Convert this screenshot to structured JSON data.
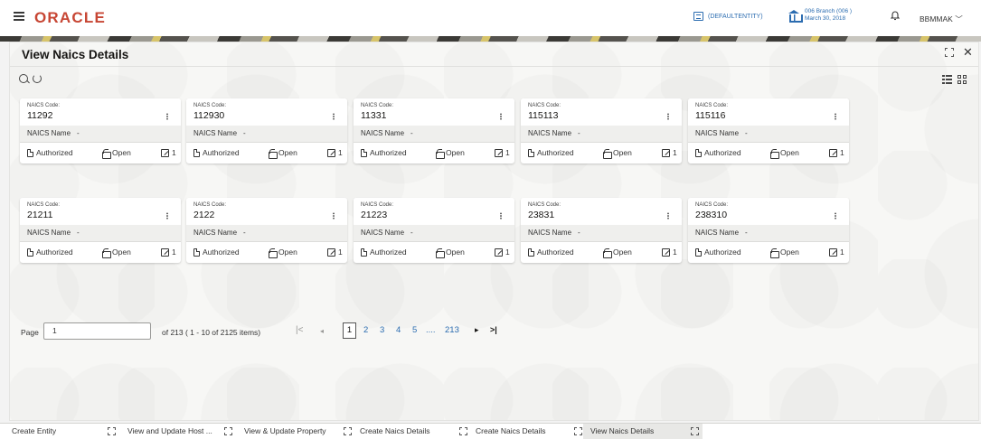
{
  "header": {
    "logo": "ORACLE",
    "entity": "(DEFAULTENTITY)",
    "branch_line1": "006 Branch (006 )",
    "branch_line2": "March 30, 2018",
    "user": "BBMMAK"
  },
  "panel": {
    "title": "View Naics Details"
  },
  "cards": [
    {
      "code_label": "NAICS Code:",
      "code": "11292",
      "name_label": "NAICS Name",
      "name": "-",
      "status": "Authorized",
      "state": "Open",
      "count": "1"
    },
    {
      "code_label": "NAICS Code:",
      "code": "112930",
      "name_label": "NAICS Name",
      "name": "-",
      "status": "Authorized",
      "state": "Open",
      "count": "1"
    },
    {
      "code_label": "NAICS Code:",
      "code": "11331",
      "name_label": "NAICS Name",
      "name": "-",
      "status": "Authorized",
      "state": "Open",
      "count": "1"
    },
    {
      "code_label": "NAICS Code:",
      "code": "115113",
      "name_label": "NAICS Name",
      "name": "-",
      "status": "Authorized",
      "state": "Open",
      "count": "1"
    },
    {
      "code_label": "NAICS Code:",
      "code": "115116",
      "name_label": "NAICS Name",
      "name": "-",
      "status": "Authorized",
      "state": "Open",
      "count": "1"
    },
    {
      "code_label": "NAICS Code:",
      "code": "21211",
      "name_label": "NAICS Name",
      "name": "-",
      "status": "Authorized",
      "state": "Open",
      "count": "1"
    },
    {
      "code_label": "NAICS Code:",
      "code": "2122",
      "name_label": "NAICS Name",
      "name": "-",
      "status": "Authorized",
      "state": "Open",
      "count": "1"
    },
    {
      "code_label": "NAICS Code:",
      "code": "21223",
      "name_label": "NAICS Name",
      "name": "-",
      "status": "Authorized",
      "state": "Open",
      "count": "1"
    },
    {
      "code_label": "NAICS Code:",
      "code": "23831",
      "name_label": "NAICS Name",
      "name": "-",
      "status": "Authorized",
      "state": "Open",
      "count": "1"
    },
    {
      "code_label": "NAICS Code:",
      "code": "238310",
      "name_label": "NAICS Name",
      "name": "-",
      "status": "Authorized",
      "state": "Open",
      "count": "1"
    }
  ],
  "pagination": {
    "label": "Page",
    "value": "1",
    "of_text": "of 213   ( 1 - 10 of 2125 items)",
    "first": "|<",
    "prev": "◂",
    "current": "1",
    "pages": [
      "2",
      "3",
      "4",
      "5"
    ],
    "ellipsis": "....",
    "last_page": "213",
    "next": "▸",
    "last": ">|"
  },
  "tabs": [
    "Create Entity",
    "View and Update Host ...",
    "View & Update Property",
    "Create Naics Details",
    "Create Naics Details",
    "View Naics Details"
  ],
  "colors": {
    "brand": "#c74634",
    "link": "#2b6cb0",
    "active_tab": "#e8e8e6"
  }
}
